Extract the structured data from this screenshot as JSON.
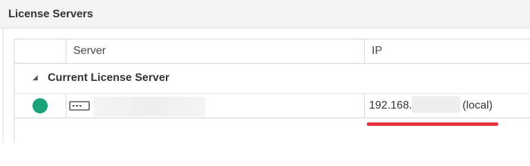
{
  "section": {
    "title": "License Servers"
  },
  "table": {
    "columns": [
      "",
      "Server",
      "IP"
    ],
    "group": {
      "label": "Current License Server",
      "expanded": true
    },
    "rows": [
      {
        "status": "online",
        "status_color": "#1aa37a",
        "server_icon": "server-icon",
        "ip_prefix": "192.168.",
        "ip_suffix": "(local)"
      }
    ]
  },
  "annotation": {
    "underline_color": "#e5333e"
  }
}
